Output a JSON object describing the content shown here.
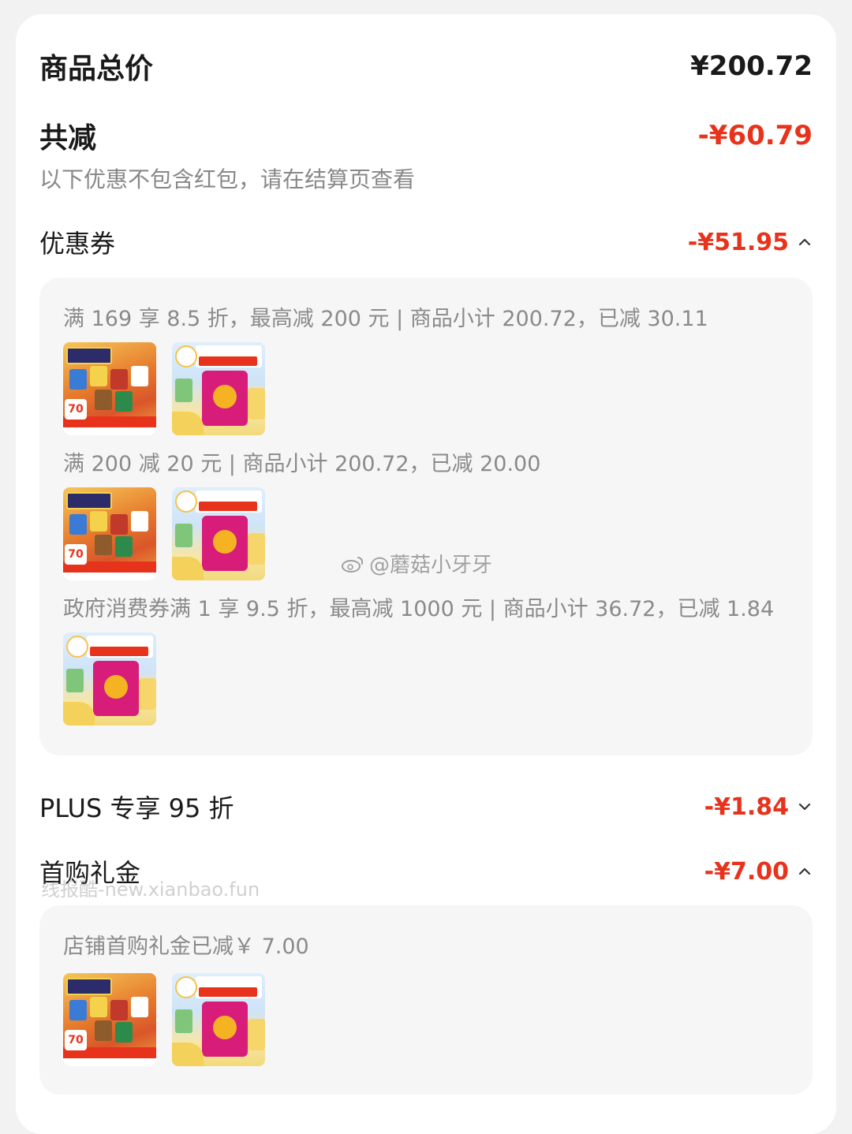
{
  "summary": {
    "total_label": "商品总价",
    "total_value": "¥200.72",
    "reduce_label": "共减",
    "reduce_value": "-¥60.79",
    "note": "以下优惠不包含红包，请在结算页查看"
  },
  "coupon": {
    "label": "优惠券",
    "value": "-¥51.95",
    "expanded": true,
    "rules": [
      {
        "text": "满 169 享 8.5 折，最高减 200 元 | 商品小计 200.72，已减 30.11",
        "products": [
          "snack-gift-box",
          "milk-calcium-cheese"
        ]
      },
      {
        "text": "满 200 减 20 元 | 商品小计 200.72，已减 20.00",
        "products": [
          "snack-gift-box",
          "milk-calcium-cheese"
        ]
      },
      {
        "text": "政府消费券满 1 享 9.5 折，最高减 1000 元 | 商品小计 36.72，已减 1.84",
        "products": [
          "milk-calcium-cheese"
        ]
      }
    ]
  },
  "plus": {
    "label": "PLUS 专享 95 折",
    "value": "-¥1.84",
    "expanded": false
  },
  "first_buy": {
    "label": "首购礼金",
    "value": "-¥7.00",
    "expanded": true,
    "detail": "店铺首购礼金已减￥ 7.00",
    "products": [
      "snack-gift-box",
      "milk-calcium-cheese"
    ]
  },
  "product_images": {
    "snack-gift-box": {
      "badge": "70"
    },
    "milk-calcium-cheese": {}
  },
  "watermarks": {
    "site": "线报酷-new.xianbao.fun",
    "weibo": "@蘑菇小牙牙"
  },
  "colors": {
    "accent_red": "#e8331c",
    "panel_bg": "#f6f6f6",
    "text_gray": "#8a8a8a"
  }
}
